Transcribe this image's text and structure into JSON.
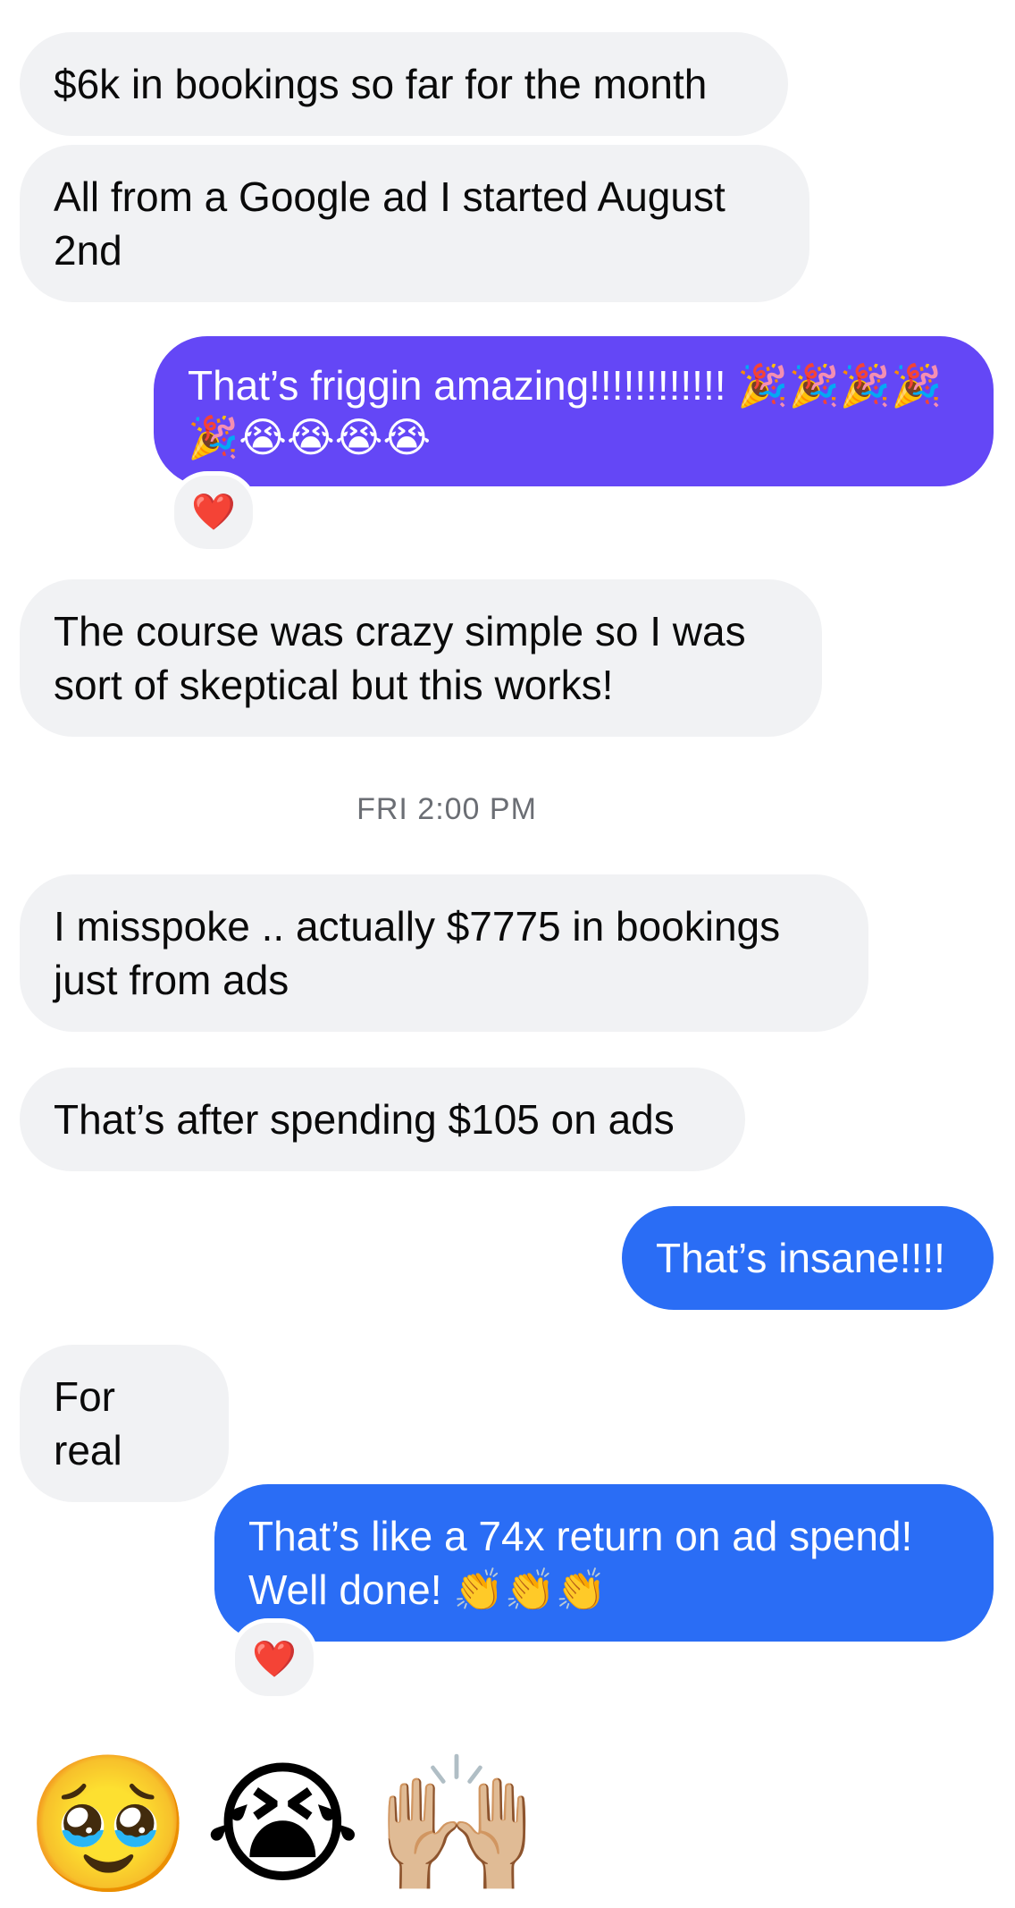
{
  "conversation": {
    "messages": [
      {
        "direction": "incoming",
        "text": "$6k in bookings so far for the month"
      },
      {
        "direction": "incoming",
        "text": "All from a Google ad I started August 2nd"
      },
      {
        "direction": "outgoing",
        "text": "That’s friggin amazing!!!!!!!!!!!! 🎉🎉🎉🎉🎉😭😭😭😭",
        "reaction": "❤️"
      },
      {
        "direction": "incoming",
        "text": "The course was crazy simple so I was sort of skeptical but this works!"
      },
      {
        "direction": "incoming",
        "text": "I misspoke .. actually $7775 in bookings just from ads"
      },
      {
        "direction": "incoming",
        "text": "That’s after spending $105 on ads"
      },
      {
        "direction": "outgoing",
        "text": "That’s insane!!!!"
      },
      {
        "direction": "incoming",
        "text": "For real"
      },
      {
        "direction": "outgoing",
        "text": "That’s like a 74x return on ad spend! Well done! 👏👏👏",
        "reaction": "❤️"
      }
    ],
    "timestamp": "FRI 2:00 PM",
    "big_emoji": "🥹😭🙌🏼"
  },
  "colors": {
    "incoming_bubble": "#f1f2f4",
    "outgoing_purple": "#6447f6",
    "outgoing_blue": "#2a6df5",
    "timestamp_text": "#6b6e74"
  }
}
